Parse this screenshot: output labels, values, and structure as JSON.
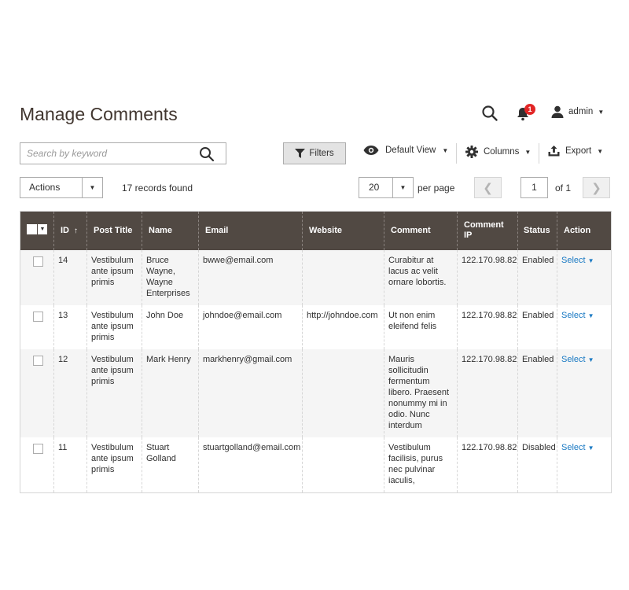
{
  "page": {
    "title": "Manage Comments",
    "notifications_count": "1",
    "user_name": "admin"
  },
  "toolbar": {
    "search_placeholder": "Search by keyword",
    "filters_label": "Filters",
    "view_label": "Default View",
    "columns_label": "Columns",
    "export_label": "Export",
    "actions_label": "Actions",
    "records_found": "17 records found",
    "per_page_value": "20",
    "per_page_label": "per page",
    "current_page": "1",
    "total_pages": "of 1"
  },
  "grid": {
    "columns": [
      "ID",
      "Post Title",
      "Name",
      "Email",
      "Website",
      "Comment",
      "Comment IP",
      "Status",
      "Action"
    ],
    "rows": [
      {
        "id": "14",
        "post_title": "Vestibulum ante ipsum primis",
        "name": "Bruce Wayne, Wayne Enterprises",
        "email": "bwwe@email.com",
        "website": "",
        "comment": "Curabitur at lacus ac velit ornare lobortis.",
        "ip": "122.170.98.82",
        "status": "Enabled",
        "action": "Select"
      },
      {
        "id": "13",
        "post_title": "Vestibulum ante ipsum primis",
        "name": "John Doe",
        "email": "johndoe@email.com",
        "website": "http://johndoe.com",
        "comment": "Ut non enim eleifend felis",
        "ip": "122.170.98.82",
        "status": "Enabled",
        "action": "Select"
      },
      {
        "id": "12",
        "post_title": "Vestibulum ante ipsum primis",
        "name": "Mark Henry",
        "email": "markhenry@gmail.com",
        "website": "",
        "comment": "Mauris sollicitudin fermentum libero. Praesent nonummy mi in odio. Nunc interdum",
        "ip": "122.170.98.82",
        "status": "Enabled",
        "action": "Select"
      },
      {
        "id": "11",
        "post_title": "Vestibulum ante ipsum primis",
        "name": "Stuart Golland",
        "email": "stuartgolland@email.com",
        "website": "",
        "comment": "Vestibulum facilisis, purus nec pulvinar iaculis,",
        "ip": "122.170.98.82",
        "status": "Disabled",
        "action": "Select"
      }
    ]
  },
  "colors": {
    "header_bg": "#514943",
    "link": "#1979c3",
    "badge": "#e22626"
  }
}
